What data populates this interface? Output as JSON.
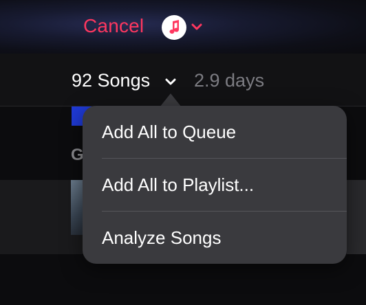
{
  "header": {
    "cancel_label": "Cancel",
    "app_icon": "music-note-icon",
    "switcher_icon": "chevron-down-icon",
    "accent_color": "#ff375f"
  },
  "summary": {
    "song_count_label": "92 Songs",
    "duration_label": "2.9 days",
    "dropdown_icon": "chevron-down-icon"
  },
  "background": {
    "section_initial": "G"
  },
  "menu": {
    "items": [
      {
        "label": "Add All to Queue"
      },
      {
        "label": "Add All to Playlist..."
      },
      {
        "label": "Analyze Songs"
      }
    ]
  }
}
